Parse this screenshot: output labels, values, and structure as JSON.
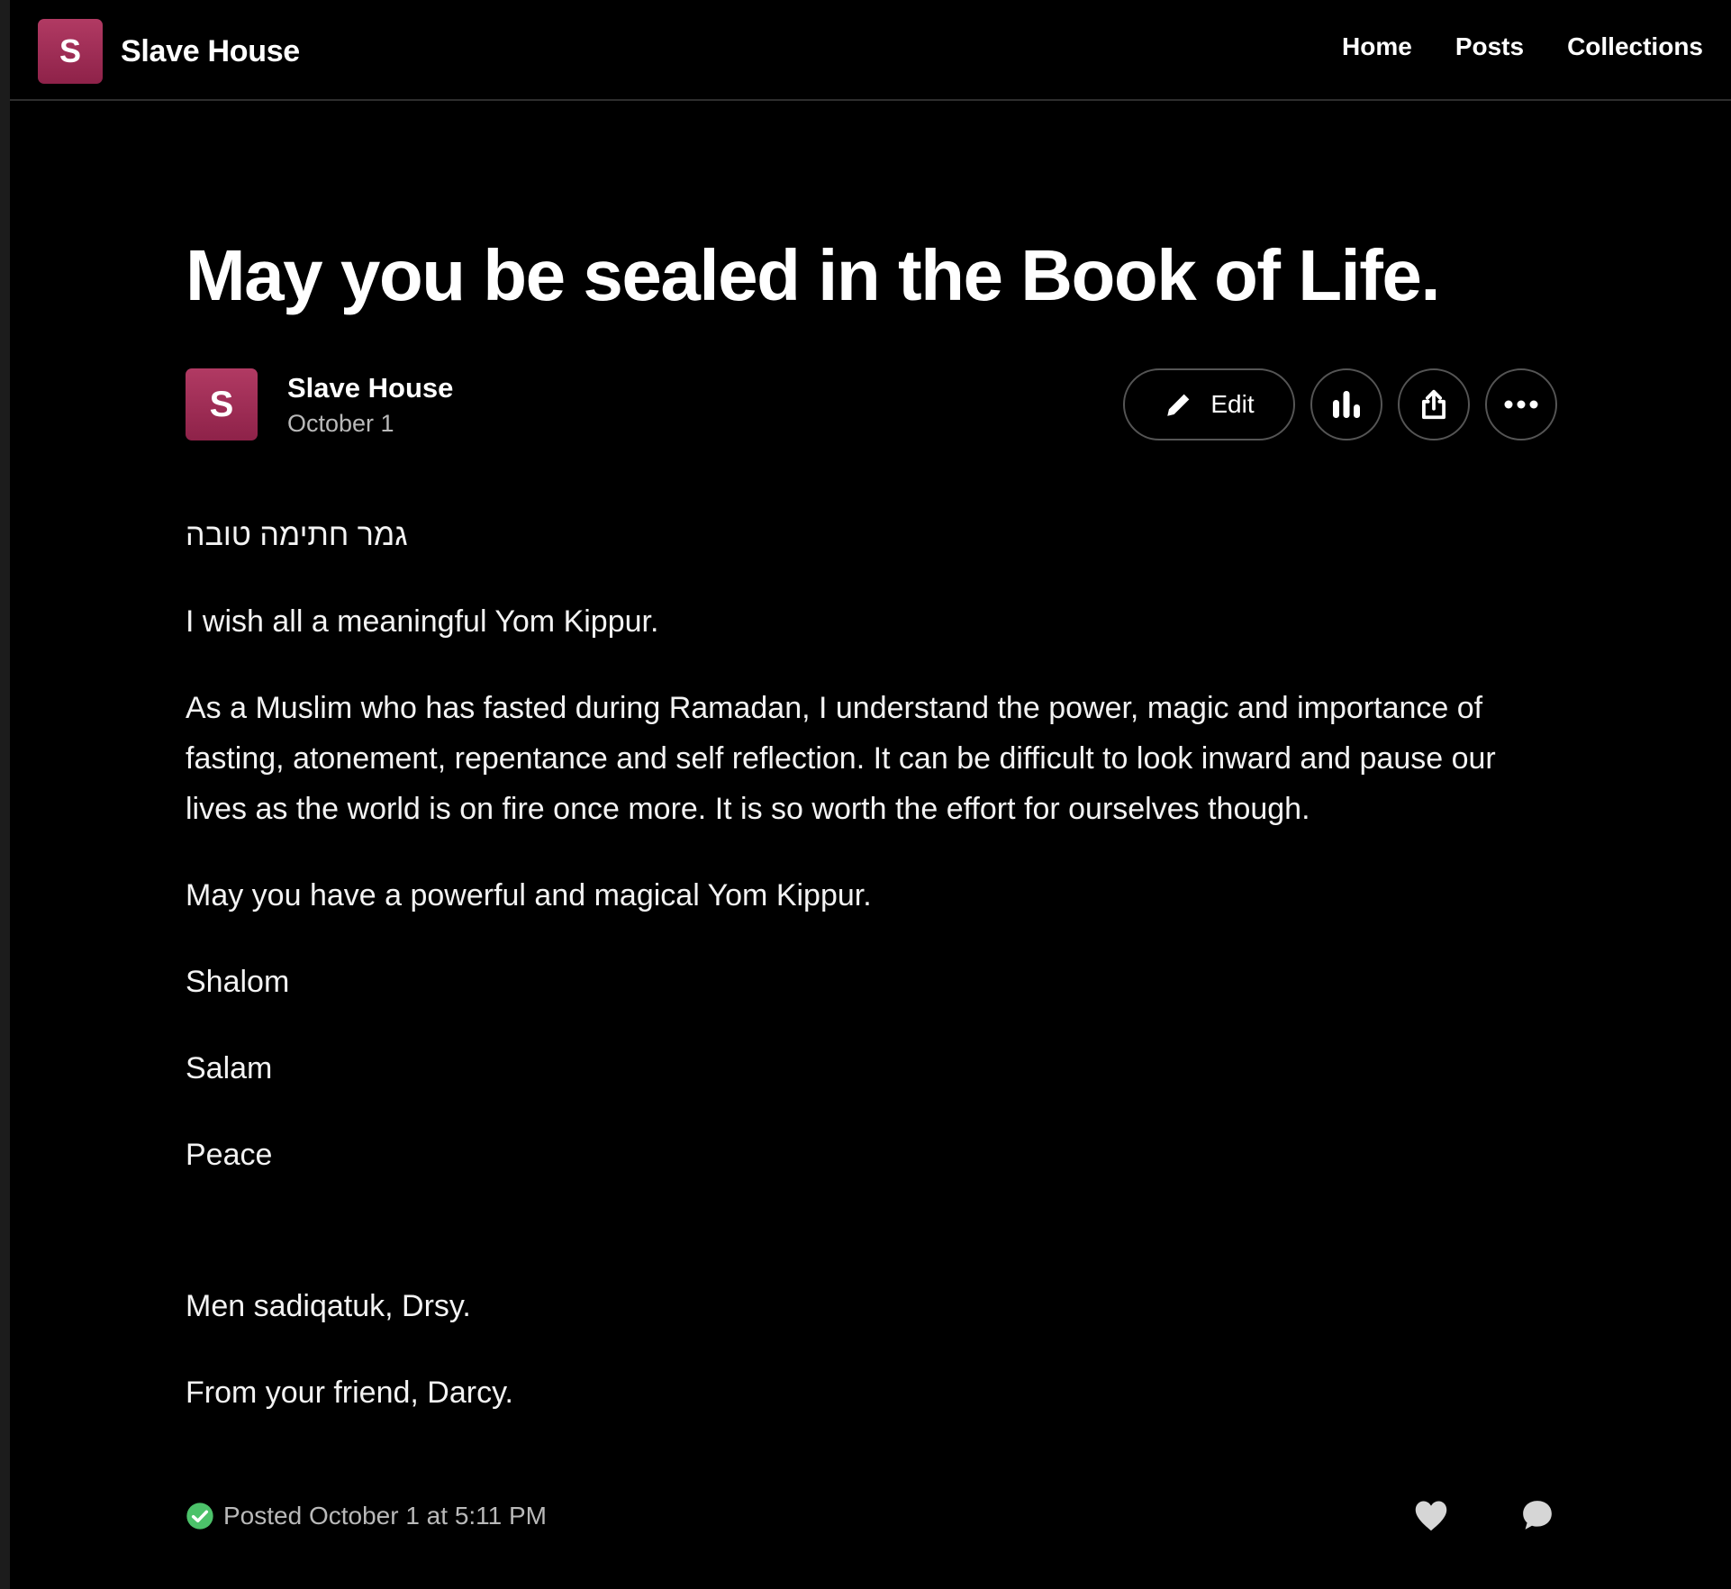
{
  "header": {
    "brand_initial": "S",
    "brand_name": "Slave House",
    "nav": [
      "Home",
      "Posts",
      "Collections"
    ]
  },
  "post": {
    "title": "May you be sealed in the Book of Life.",
    "author_initial": "S",
    "author": "Slave House",
    "date": "October 1",
    "actions": {
      "edit_label": "Edit",
      "stats_icon": "bar-chart-icon",
      "share_icon": "share-icon",
      "more_icon": "more-dots-icon"
    },
    "paragraphs": [
      "גמר חתימה טובה",
      "I wish all a meaningful Yom Kippur.",
      "As a Muslim who has fasted during Ramadan, I understand the power, magic and importance of fasting, atonement, repentance and self reflection. It can be difficult to look inward and pause our lives as the world is on fire once more. It is so worth the effort for ourselves though.",
      "May you have a powerful and magical Yom Kippur.",
      "Shalom",
      "Salam",
      "Peace",
      "Men sadiqatuk, Drsy.",
      "From your friend, Darcy."
    ],
    "footer": {
      "posted_text": "Posted October 1 at 5:11 PM",
      "status_icon": "check-circle-icon",
      "like_icon": "heart-icon",
      "comment_icon": "comment-icon"
    }
  },
  "colors": {
    "background": "#000000",
    "avatar": "#a42d58",
    "posted_check": "#4cc26a"
  }
}
